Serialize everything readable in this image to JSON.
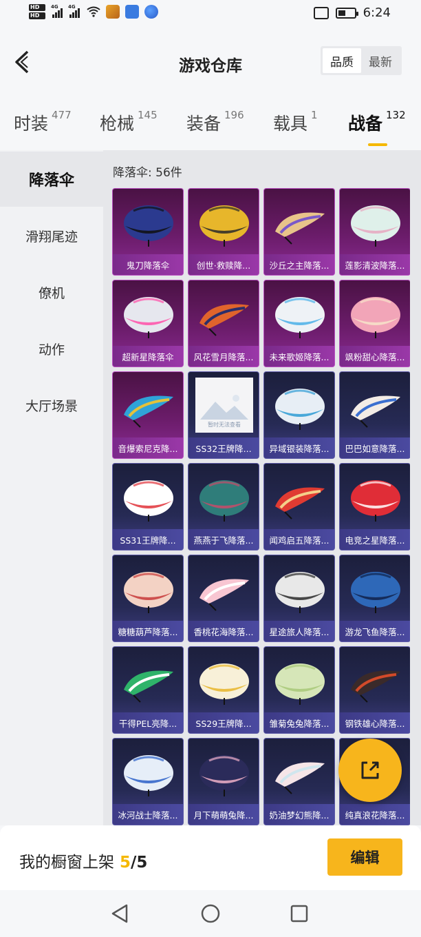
{
  "status_bar": {
    "time": "6:24",
    "network_1": "4G",
    "network_2": "4G",
    "hd_1": "HD",
    "hd_2": "HD",
    "battery_level": 0.45,
    "icons": [
      "hd-icon",
      "signal-icon",
      "wifi-icon",
      "app-notification-icon",
      "vibrate-icon",
      "battery-icon"
    ]
  },
  "header": {
    "title": "游戏仓库",
    "sort": [
      "品质",
      "最新"
    ],
    "sort_active": 0,
    "back_icon": "chevron-left-icon"
  },
  "tabs": [
    {
      "label": "时装",
      "count": "477"
    },
    {
      "label": "枪械",
      "count": "145"
    },
    {
      "label": "装备",
      "count": "196"
    },
    {
      "label": "载具",
      "count": "1"
    },
    {
      "label": "战备",
      "count": "132",
      "active": true
    }
  ],
  "sidebar": [
    {
      "label": "降落伞",
      "active": true
    },
    {
      "label": "滑翔尾迹"
    },
    {
      "label": "僚机"
    },
    {
      "label": "动作"
    },
    {
      "label": "大厅场景"
    }
  ],
  "category_count": "降落伞: 56件",
  "items": [
    {
      "name": "鬼刀降落伞",
      "rarity": "rare",
      "color1": "#2b3a8f",
      "color2": "#111"
    },
    {
      "name": "创世·救赎降...",
      "rarity": "rare",
      "color1": "#e7b62b",
      "color2": "#2a2a2a"
    },
    {
      "name": "沙丘之主降落...",
      "rarity": "rare",
      "color1": "#e8c48a",
      "color2": "#7a59c9"
    },
    {
      "name": "莲影清波降落...",
      "rarity": "rare",
      "color1": "#dff0ea",
      "color2": "#e7a7c0"
    },
    {
      "name": "超新星降落伞",
      "rarity": "rare",
      "color1": "#e6e7ee",
      "color2": "#ff4fa8"
    },
    {
      "name": "风花雪月降落...",
      "rarity": "rare",
      "color1": "#e0642c",
      "color2": "#2b2e6a"
    },
    {
      "name": "未来歌姬降落...",
      "rarity": "rare",
      "color1": "#eef2f6",
      "color2": "#4ab0e8"
    },
    {
      "name": "飒粉甜心降落...",
      "rarity": "rare",
      "color1": "#f2a5b8",
      "color2": "#f7e3c9"
    },
    {
      "name": "音爆索尼克降...",
      "rarity": "rare",
      "color1": "#2fa3d8",
      "color2": "#e4c13a"
    },
    {
      "name": "SS32王牌降...",
      "rarity": "norm",
      "placeholder": true,
      "placeholder_text": "暂时无法查看"
    },
    {
      "name": "异域银装降落...",
      "rarity": "norm",
      "color1": "#e7eef5",
      "color2": "#2d9bd4"
    },
    {
      "name": "巴巴如意降落...",
      "rarity": "norm",
      "color1": "#f3ece6",
      "color2": "#3b6fd0"
    },
    {
      "name": "SS31王牌降...",
      "rarity": "norm",
      "color1": "#ffffff",
      "color2": "#e0323a"
    },
    {
      "name": "燕燕于飞降落...",
      "rarity": "norm",
      "color1": "#2f7d7a",
      "color2": "#c94a6a"
    },
    {
      "name": "闻鸡启五降落...",
      "rarity": "norm",
      "color1": "#e03b32",
      "color2": "#f4d08a"
    },
    {
      "name": "电竞之星降落...",
      "rarity": "norm",
      "color1": "#e02d37",
      "color2": "#ffffff"
    },
    {
      "name": "糖糖葫芦降落...",
      "rarity": "norm",
      "color1": "#f3d2c4",
      "color2": "#c73a3a"
    },
    {
      "name": "香桃花海降落...",
      "rarity": "norm",
      "color1": "#f8c6d2",
      "color2": "#ffffff"
    },
    {
      "name": "星途旅人降落...",
      "rarity": "norm",
      "color1": "#e8e8e8",
      "color2": "#2a2a2a"
    },
    {
      "name": "游龙飞鱼降落...",
      "rarity": "norm",
      "color1": "#2e68b8",
      "color2": "#10224a"
    },
    {
      "name": "干得PEL亮降...",
      "rarity": "norm",
      "color1": "#2fb36a",
      "color2": "#ffffff"
    },
    {
      "name": "SS29王牌降...",
      "rarity": "norm",
      "color1": "#f8f0d8",
      "color2": "#e8b52a"
    },
    {
      "name": "雏菊兔兔降落...",
      "rarity": "norm",
      "color1": "#d6e6b8",
      "color2": "#a8c878"
    },
    {
      "name": "钢铁雄心降落...",
      "rarity": "norm",
      "color1": "#3a2a2a",
      "color2": "#d24a2a"
    },
    {
      "name": "冰河战士降落...",
      "rarity": "norm",
      "color1": "#e6eef8",
      "color2": "#2a5fc8"
    },
    {
      "name": "月下萌萌兔降...",
      "rarity": "norm",
      "color1": "#2b2b5a",
      "color2": "#f0b0c8"
    },
    {
      "name": "奶油梦幻熊降...",
      "rarity": "norm",
      "color1": "#f6e6e8",
      "color2": "#d0e6ee"
    },
    {
      "name": "纯真浪花降落...",
      "rarity": "norm",
      "color1": "#f2f6fa",
      "color2": "#7ab8e0"
    }
  ],
  "fab": {
    "icon": "share-external-icon"
  },
  "bottom": {
    "shelf_label": "我的橱窗上架",
    "shelf_count": "5",
    "shelf_sep": "/",
    "shelf_total": "5",
    "edit_label": "编辑"
  },
  "navbar": {
    "icons": [
      "back-triangle-icon",
      "home-circle-icon",
      "recents-square-icon"
    ]
  },
  "colors": {
    "accent": "#f7b51c",
    "rare_card": "#6b1c6a",
    "normal_card": "#262a54"
  }
}
